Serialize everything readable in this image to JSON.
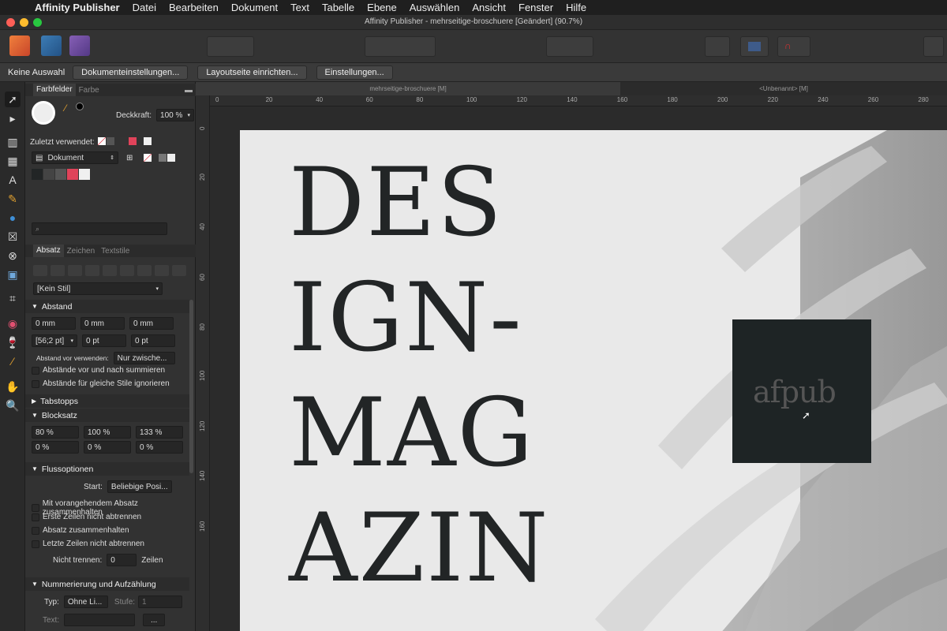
{
  "menubar": {
    "app_name": "Affinity Publisher",
    "items": [
      "Datei",
      "Bearbeiten",
      "Dokument",
      "Text",
      "Tabelle",
      "Ebene",
      "Auswählen",
      "Ansicht",
      "Fenster",
      "Hilfe"
    ]
  },
  "window": {
    "title": "Affinity Publisher - mehrseitige-broschuere [Geändert] (90.7%)"
  },
  "context": {
    "label": "Keine Auswahl",
    "btn1": "Dokumenteinstellungen...",
    "btn2": "Layoutseite einrichten...",
    "btn3": "Einstellungen..."
  },
  "swatches": {
    "tab_active": "Farbfelder",
    "tab_inactive": "Farbe",
    "opacity_label": "Deckkraft:",
    "opacity_value": "100 %",
    "recent_label": "Zuletzt verwendet:",
    "palette": "Dokument",
    "palette_colors": [
      "#222526",
      "#555555",
      "#e0435a",
      "#f0f0f0"
    ]
  },
  "paragraph": {
    "tab_active": "Absatz",
    "tab2": "Zeichen",
    "tab3": "Textstile",
    "style": "[Kein Stil]",
    "section_spacing": "Abstand",
    "indent_left": "0 mm",
    "indent_right": "0 mm",
    "indent_first": "0 mm",
    "leading": "[56;2 pt]",
    "space_before": "0 pt",
    "space_after": "0 pt",
    "apply_label": "Abstand vor verwenden:",
    "apply_value": "Nur zwische...",
    "check1": "Abstände vor und nach summieren",
    "check2": "Abstände für gleiche Stile ignorieren",
    "section_tabs": "Tabstopps",
    "section_justify": "Blocksatz",
    "word_min": "80 %",
    "word_des": "100 %",
    "word_max": "133 %",
    "letter_min": "0 %",
    "letter_des": "0 %",
    "letter_max": "0 %",
    "section_flow": "Flussoptionen",
    "start_label": "Start:",
    "start_value": "Beliebige Posi...",
    "flow1": "Mit vorangehendem Absatz zusammenhalten",
    "flow2": "Erste Zeilen nicht abtrennen",
    "flow3": "Absatz zusammenhalten",
    "flow4": "Letzte Zeilen nicht abtrennen",
    "nobreak_label": "Nicht trennen:",
    "nobreak_value": "0",
    "nobreak_unit": "Zeilen",
    "section_list": "Nummerierung und Aufzählung",
    "type_label": "Typ:",
    "type_value": "Ohne Li...",
    "level_label": "Stufe:",
    "level_value": "1",
    "text_label": "Text:",
    "text_btn": "..."
  },
  "doc_tabs": {
    "tab1": "mehrseitige-broschuere [M]",
    "tab2": "<Unbenannt> [M]"
  },
  "ruler": {
    "unit": "mm",
    "h_ticks": [
      "0",
      "20",
      "40",
      "60",
      "80",
      "100",
      "120",
      "140",
      "160",
      "180",
      "200",
      "220",
      "240",
      "260",
      "280"
    ],
    "v_ticks": [
      "0",
      "20",
      "40",
      "60",
      "80",
      "100",
      "120",
      "140",
      "160"
    ]
  },
  "page": {
    "lines": [
      "DES",
      "IGN-",
      "MAG",
      "AZIN"
    ],
    "logo_text": "afpub"
  }
}
